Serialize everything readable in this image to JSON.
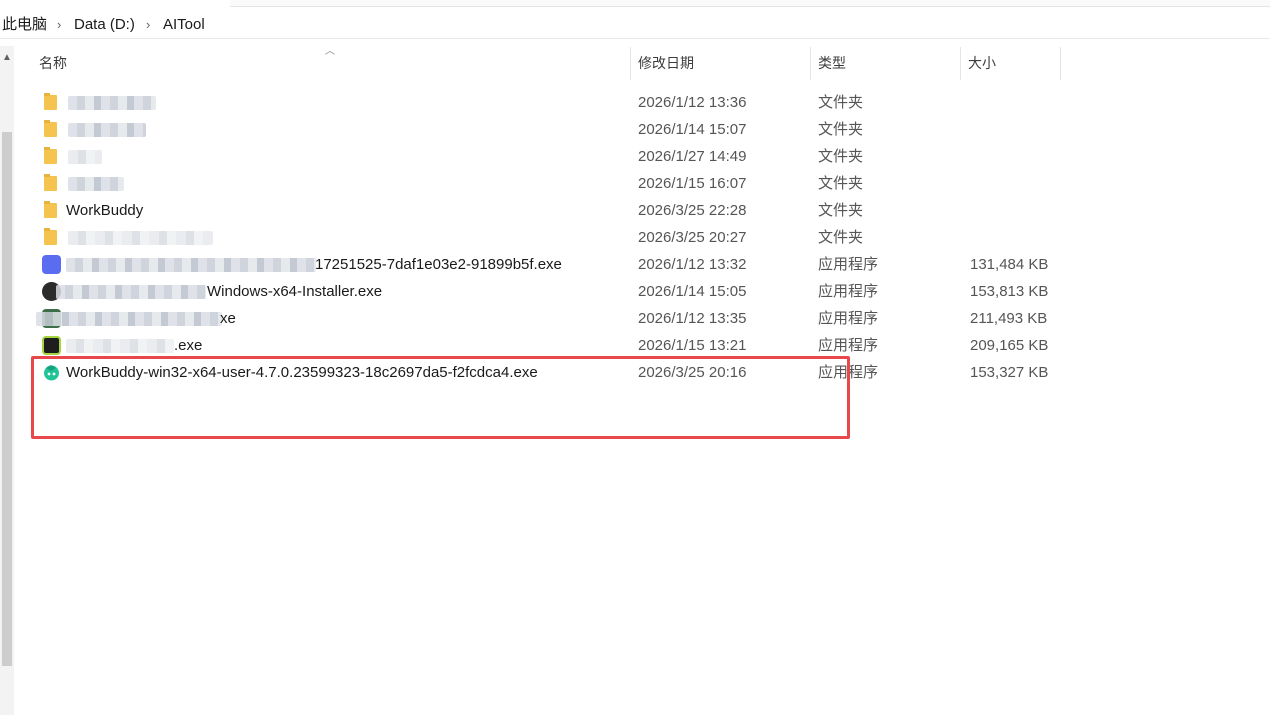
{
  "breadcrumb": [
    "此电脑",
    "Data (D:)",
    "AITool"
  ],
  "columns": {
    "name": "名称",
    "date": "修改日期",
    "type": "类型",
    "size": "大小"
  },
  "rows": [
    {
      "name": "",
      "date": "2026/1/12 13:36",
      "type": "文件夹",
      "size": ""
    },
    {
      "name": "",
      "date": "2026/1/14 15:07",
      "type": "文件夹",
      "size": ""
    },
    {
      "name": "",
      "date": "2026/1/27 14:49",
      "type": "文件夹",
      "size": ""
    },
    {
      "name": "",
      "date": "2026/1/15 16:07",
      "type": "文件夹",
      "size": ""
    },
    {
      "name": "WorkBuddy",
      "date": "2026/3/25 22:28",
      "type": "文件夹",
      "size": ""
    },
    {
      "name": "",
      "date": "2026/3/25 20:27",
      "type": "文件夹",
      "size": ""
    },
    {
      "name": "17251525-7daf1e03e2-91899b5f.exe",
      "date": "2026/1/12 13:32",
      "type": "应用程序",
      "size": "131,484 KB"
    },
    {
      "name": "Windows-x64-Installer.exe",
      "date": "2026/1/14 15:05",
      "type": "应用程序",
      "size": "153,813 KB"
    },
    {
      "name": "xe",
      "date": "2026/1/12 13:35",
      "type": "应用程序",
      "size": "211,493 KB"
    },
    {
      "name": ".exe",
      "date": "2026/1/15 13:21",
      "type": "应用程序",
      "size": "209,165 KB"
    },
    {
      "name": "WorkBuddy-win32-x64-user-4.7.0.23599323-18c2697da5-f2fcdca4.exe",
      "date": "2026/3/25 20:16",
      "type": "应用程序",
      "size": "153,327 KB"
    }
  ],
  "icons": [
    "folder-icon",
    "app-icon",
    "workbuddy-icon",
    "chevron-right-icon",
    "sort-up-icon"
  ],
  "colors": {
    "highlight_border": "#e8474c",
    "folder": "#f4c44e",
    "workbuddy_icon": "#22c497"
  }
}
